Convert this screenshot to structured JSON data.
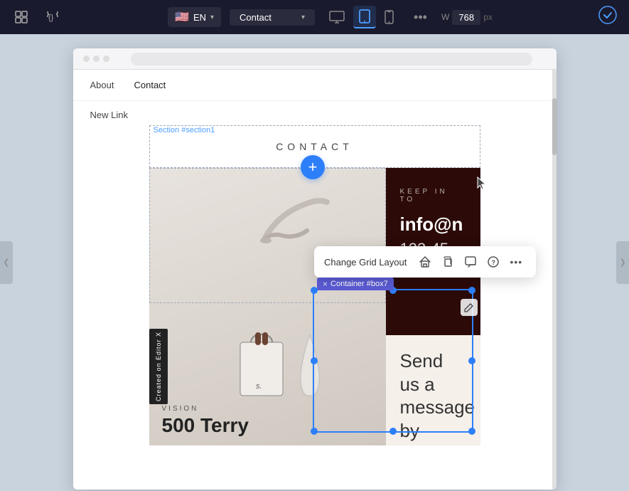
{
  "toolbar": {
    "lang_flag": "🇺🇸",
    "lang_code": "EN",
    "lang_chevron": "▾",
    "page_name": "Contact",
    "page_chevron": "▾",
    "device_desktop_icon": "□",
    "device_tablet_icon": "▭",
    "device_mobile_icon": "▯",
    "more_icon": "•••",
    "width_label": "W",
    "width_value": "768",
    "width_unit": "px",
    "check_icon": "✓",
    "grid_icon": "⊞",
    "curly_icon": "{}"
  },
  "canvas": {
    "section_label": "Section #section1",
    "add_button_label": "+",
    "container_tag": "Container #box7",
    "cursor_label": "cursor"
  },
  "floating_toolbar": {
    "label": "Change Grid Layout",
    "icon_grid": "◇",
    "icon_copy": "⧉",
    "icon_comment": "□",
    "icon_help": "?",
    "icon_more": "•••"
  },
  "nav": {
    "about_label": "About",
    "contact_label": "Contact",
    "new_link_label": "New Link"
  },
  "page_title": "CONTACT",
  "left_panel": {
    "bottom_label": "VISION",
    "bottom_title": "500 Terry"
  },
  "right_panel": {
    "keep_label": "KEEP IN TO",
    "email": "info@n",
    "phone": "123-45",
    "send_message": "Send us a message",
    "send_message_2": "by using our"
  },
  "editor_badge": "Created on Editor X",
  "browser": {
    "url_placeholder": ""
  },
  "colors": {
    "accent_blue": "#2d7ff9",
    "dark_panel": "#2c0a08",
    "nav_bg": "#ffffff",
    "container_tag_bg": "#5b5bd6"
  }
}
